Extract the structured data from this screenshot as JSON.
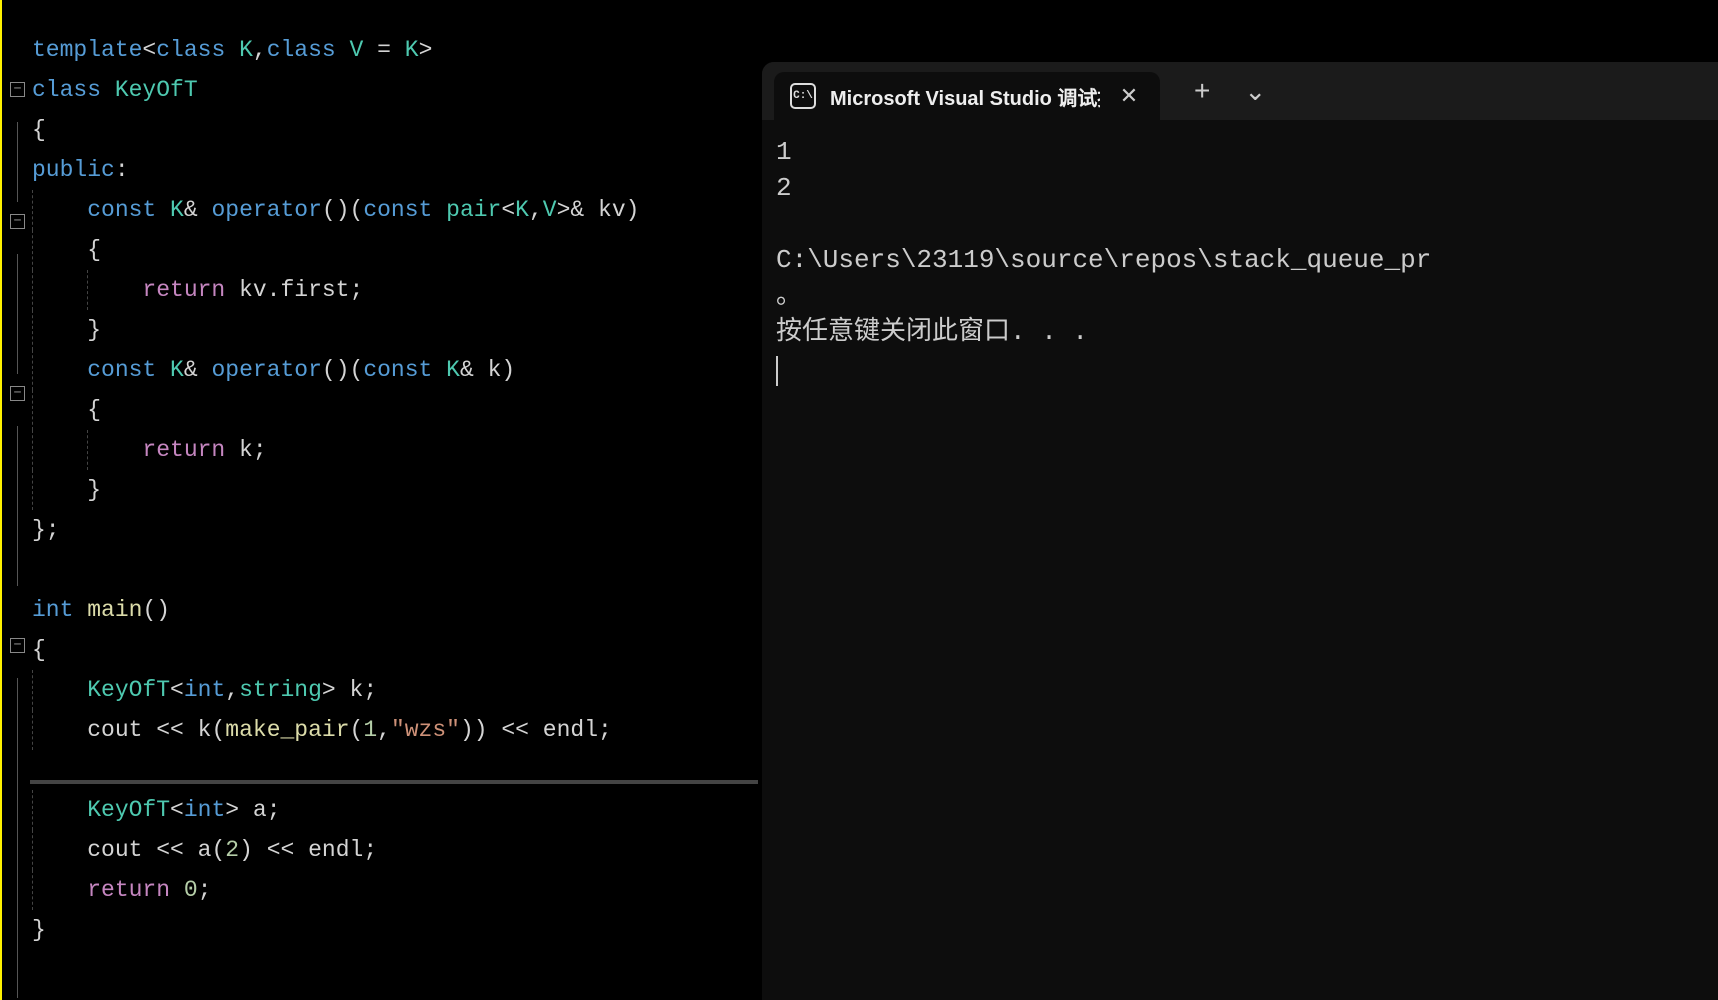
{
  "editor": {
    "code_lines": [
      {
        "indent": 0,
        "fold": false,
        "tokens": [
          {
            "t": "kw",
            "v": "template"
          },
          {
            "t": "op",
            "v": "<"
          },
          {
            "t": "kw",
            "v": "class"
          },
          {
            "t": "op",
            "v": " "
          },
          {
            "t": "type",
            "v": "K"
          },
          {
            "t": "op",
            "v": ","
          },
          {
            "t": "kw",
            "v": "class"
          },
          {
            "t": "op",
            "v": " "
          },
          {
            "t": "type",
            "v": "V"
          },
          {
            "t": "op",
            "v": " = "
          },
          {
            "t": "type",
            "v": "K"
          },
          {
            "t": "op",
            "v": ">"
          }
        ]
      },
      {
        "indent": 0,
        "fold": true,
        "tokens": [
          {
            "t": "kw",
            "v": "class"
          },
          {
            "t": "op",
            "v": " "
          },
          {
            "t": "classname",
            "v": "KeyOfT"
          }
        ]
      },
      {
        "indent": 0,
        "fold": false,
        "tokens": [
          {
            "t": "brace",
            "v": "{"
          }
        ]
      },
      {
        "indent": 0,
        "fold": false,
        "tokens": [
          {
            "t": "kw",
            "v": "public"
          },
          {
            "t": "op",
            "v": ":"
          }
        ]
      },
      {
        "indent": 1,
        "fold": true,
        "tokens": [
          {
            "t": "kw",
            "v": "const"
          },
          {
            "t": "op",
            "v": " "
          },
          {
            "t": "type",
            "v": "K"
          },
          {
            "t": "op",
            "v": "& "
          },
          {
            "t": "kw",
            "v": "operator"
          },
          {
            "t": "op",
            "v": "()("
          },
          {
            "t": "kw",
            "v": "const"
          },
          {
            "t": "op",
            "v": " "
          },
          {
            "t": "type",
            "v": "pair"
          },
          {
            "t": "op",
            "v": "<"
          },
          {
            "t": "type",
            "v": "K"
          },
          {
            "t": "op",
            "v": ","
          },
          {
            "t": "type",
            "v": "V"
          },
          {
            "t": "op",
            "v": ">& "
          },
          {
            "t": "ident",
            "v": "kv"
          },
          {
            "t": "op",
            "v": ")"
          }
        ]
      },
      {
        "indent": 1,
        "fold": false,
        "tokens": [
          {
            "t": "brace",
            "v": "{"
          }
        ]
      },
      {
        "indent": 2,
        "fold": false,
        "tokens": [
          {
            "t": "keyword2",
            "v": "return"
          },
          {
            "t": "op",
            "v": " kv."
          },
          {
            "t": "ident",
            "v": "first"
          },
          {
            "t": "op",
            "v": ";"
          }
        ]
      },
      {
        "indent": 1,
        "fold": false,
        "tokens": [
          {
            "t": "brace",
            "v": "}"
          }
        ]
      },
      {
        "indent": 1,
        "fold": true,
        "tokens": [
          {
            "t": "kw",
            "v": "const"
          },
          {
            "t": "op",
            "v": " "
          },
          {
            "t": "type",
            "v": "K"
          },
          {
            "t": "op",
            "v": "& "
          },
          {
            "t": "kw",
            "v": "operator"
          },
          {
            "t": "op",
            "v": "()("
          },
          {
            "t": "kw",
            "v": "const"
          },
          {
            "t": "op",
            "v": " "
          },
          {
            "t": "type",
            "v": "K"
          },
          {
            "t": "op",
            "v": "& "
          },
          {
            "t": "ident",
            "v": "k"
          },
          {
            "t": "op",
            "v": ")"
          }
        ]
      },
      {
        "indent": 1,
        "fold": false,
        "tokens": [
          {
            "t": "brace",
            "v": "{"
          }
        ]
      },
      {
        "indent": 2,
        "fold": false,
        "tokens": [
          {
            "t": "keyword2",
            "v": "return"
          },
          {
            "t": "op",
            "v": " k"
          },
          {
            "t": "op",
            "v": ";"
          }
        ]
      },
      {
        "indent": 1,
        "fold": false,
        "tokens": [
          {
            "t": "brace",
            "v": "}"
          }
        ]
      },
      {
        "indent": 0,
        "fold": false,
        "tokens": [
          {
            "t": "brace",
            "v": "};"
          }
        ]
      },
      {
        "indent": 0,
        "fold": false,
        "tokens": []
      },
      {
        "indent": 0,
        "fold": true,
        "tokens": [
          {
            "t": "kw",
            "v": "int"
          },
          {
            "t": "op",
            "v": " "
          },
          {
            "t": "fn",
            "v": "main"
          },
          {
            "t": "op",
            "v": "()"
          }
        ]
      },
      {
        "indent": 0,
        "fold": false,
        "tokens": [
          {
            "t": "brace",
            "v": "{"
          }
        ]
      },
      {
        "indent": 1,
        "fold": false,
        "tokens": [
          {
            "t": "classname",
            "v": "KeyOfT"
          },
          {
            "t": "op",
            "v": "<"
          },
          {
            "t": "kw",
            "v": "int"
          },
          {
            "t": "op",
            "v": ","
          },
          {
            "t": "type",
            "v": "string"
          },
          {
            "t": "op",
            "v": "> "
          },
          {
            "t": "ident",
            "v": "k"
          },
          {
            "t": "op",
            "v": ";"
          }
        ]
      },
      {
        "indent": 1,
        "fold": false,
        "tokens": [
          {
            "t": "ident",
            "v": "cout"
          },
          {
            "t": "op",
            "v": " << "
          },
          {
            "t": "ident",
            "v": "k"
          },
          {
            "t": "op",
            "v": "("
          },
          {
            "t": "fn",
            "v": "make_pair"
          },
          {
            "t": "op",
            "v": "("
          },
          {
            "t": "num",
            "v": "1"
          },
          {
            "t": "op",
            "v": ","
          },
          {
            "t": "str",
            "v": "\"wzs\""
          },
          {
            "t": "op",
            "v": ")) << "
          },
          {
            "t": "ident",
            "v": "endl"
          },
          {
            "t": "op",
            "v": ";"
          }
        ]
      },
      {
        "indent": 0,
        "fold": false,
        "tokens": []
      },
      {
        "indent": 1,
        "fold": false,
        "tokens": [
          {
            "t": "classname",
            "v": "KeyOfT"
          },
          {
            "t": "op",
            "v": "<"
          },
          {
            "t": "kw",
            "v": "int"
          },
          {
            "t": "op",
            "v": "> "
          },
          {
            "t": "ident",
            "v": "a"
          },
          {
            "t": "op",
            "v": ";"
          }
        ]
      },
      {
        "indent": 1,
        "fold": false,
        "tokens": [
          {
            "t": "ident",
            "v": "cout"
          },
          {
            "t": "op",
            "v": " << "
          },
          {
            "t": "ident",
            "v": "a"
          },
          {
            "t": "op",
            "v": "("
          },
          {
            "t": "num",
            "v": "2"
          },
          {
            "t": "op",
            "v": ") << "
          },
          {
            "t": "ident",
            "v": "endl"
          },
          {
            "t": "op",
            "v": ";"
          }
        ]
      },
      {
        "indent": 1,
        "fold": false,
        "tokens": [
          {
            "t": "keyword2",
            "v": "return"
          },
          {
            "t": "op",
            "v": " "
          },
          {
            "t": "num",
            "v": "0"
          },
          {
            "t": "op",
            "v": ";"
          }
        ]
      },
      {
        "indent": 0,
        "fold": false,
        "tokens": [
          {
            "t": "brace",
            "v": "}"
          }
        ]
      }
    ]
  },
  "terminal": {
    "tab_title": "Microsoft Visual Studio 调试控",
    "tab_icon_label": "C:\\",
    "output_lines": [
      "1",
      "2",
      "",
      "C:\\Users\\23119\\source\\repos\\stack_queue_pr",
      "。",
      "按任意键关闭此窗口. . ."
    ]
  },
  "icons": {
    "close": "✕",
    "plus": "+",
    "chevron_down": "⌄",
    "fold_minus": "−"
  }
}
